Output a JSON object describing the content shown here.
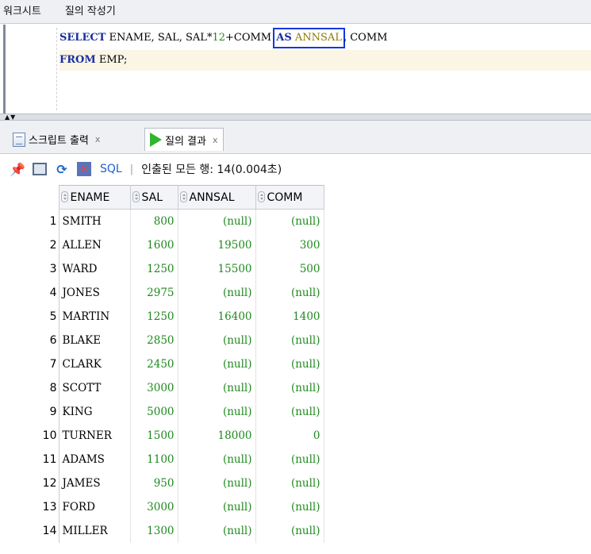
{
  "top_tabs": [
    "워크시트",
    "질의 작성기"
  ],
  "editor": {
    "line1": {
      "kw_select": "SELECT",
      "columns_part": " ENAME, SAL, SAL*",
      "number": "12",
      "after_number": "+COMM ",
      "kw_as": "AS",
      "alias": "ANNSAL",
      "tail": ", COMM"
    },
    "line2": {
      "kw_from": "FROM",
      "table": " EMP;"
    }
  },
  "result_tabs": [
    {
      "label": "스크립트 출력",
      "close": "x"
    },
    {
      "label": "질의 결과",
      "close": "x"
    }
  ],
  "toolbar": {
    "sql_label": "SQL",
    "separator": "|",
    "status": "인출된 모든 행: 14(0.004초)"
  },
  "colors": {
    "keyword": "#1a2f9e",
    "number": "#1f8a1f",
    "alias": "#8a7a00",
    "highlight_box": "#1438e0",
    "current_line": "#fbf5e6"
  },
  "grid": {
    "columns": [
      "ENAME",
      "SAL",
      "ANNSAL",
      "COMM"
    ],
    "rows": [
      {
        "n": "1",
        "ename": "SMITH",
        "sal": "800",
        "annsal": "(null)",
        "comm": "(null)"
      },
      {
        "n": "2",
        "ename": "ALLEN",
        "sal": "1600",
        "annsal": "19500",
        "comm": "300"
      },
      {
        "n": "3",
        "ename": "WARD",
        "sal": "1250",
        "annsal": "15500",
        "comm": "500"
      },
      {
        "n": "4",
        "ename": "JONES",
        "sal": "2975",
        "annsal": "(null)",
        "comm": "(null)"
      },
      {
        "n": "5",
        "ename": "MARTIN",
        "sal": "1250",
        "annsal": "16400",
        "comm": "1400"
      },
      {
        "n": "6",
        "ename": "BLAKE",
        "sal": "2850",
        "annsal": "(null)",
        "comm": "(null)"
      },
      {
        "n": "7",
        "ename": "CLARK",
        "sal": "2450",
        "annsal": "(null)",
        "comm": "(null)"
      },
      {
        "n": "8",
        "ename": "SCOTT",
        "sal": "3000",
        "annsal": "(null)",
        "comm": "(null)"
      },
      {
        "n": "9",
        "ename": "KING",
        "sal": "5000",
        "annsal": "(null)",
        "comm": "(null)"
      },
      {
        "n": "10",
        "ename": "TURNER",
        "sal": "1500",
        "annsal": "18000",
        "comm": "0"
      },
      {
        "n": "11",
        "ename": "ADAMS",
        "sal": "1100",
        "annsal": "(null)",
        "comm": "(null)"
      },
      {
        "n": "12",
        "ename": "JAMES",
        "sal": "950",
        "annsal": "(null)",
        "comm": "(null)"
      },
      {
        "n": "13",
        "ename": "FORD",
        "sal": "3000",
        "annsal": "(null)",
        "comm": "(null)"
      },
      {
        "n": "14",
        "ename": "MILLER",
        "sal": "1300",
        "annsal": "(null)",
        "comm": "(null)"
      }
    ]
  }
}
